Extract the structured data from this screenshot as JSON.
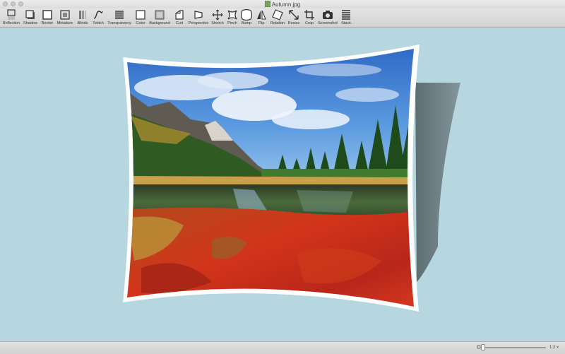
{
  "window": {
    "title": "Autumn.jpg",
    "traffic_lights": [
      "close",
      "minimize",
      "zoom"
    ]
  },
  "toolbar": {
    "items": [
      {
        "label": "Reflection",
        "icon": "reflection-icon"
      },
      {
        "label": "Shadow",
        "icon": "shadow-icon"
      },
      {
        "label": "Border",
        "icon": "border-icon"
      },
      {
        "label": "Miniature",
        "icon": "miniature-icon"
      },
      {
        "label": "Blinds",
        "icon": "blinds-icon"
      },
      {
        "label": "Twitch",
        "icon": "twitch-icon"
      },
      {
        "label": "Transparency",
        "icon": "transparency-icon"
      },
      {
        "label": "Color",
        "icon": "color-icon"
      },
      {
        "label": "Background",
        "icon": "background-icon"
      },
      {
        "label": "Curl",
        "icon": "curl-icon"
      },
      {
        "label": "Perspective",
        "icon": "perspective-icon"
      },
      {
        "label": "Stretch",
        "icon": "stretch-icon"
      },
      {
        "label": "Pinch",
        "icon": "pinch-icon"
      },
      {
        "label": "Bump",
        "icon": "bump-icon"
      },
      {
        "label": "Flip",
        "icon": "flip-icon"
      },
      {
        "label": "Rotation",
        "icon": "rotation-icon"
      },
      {
        "label": "Resize",
        "icon": "resize-icon"
      },
      {
        "label": "Crop",
        "icon": "crop-icon"
      },
      {
        "label": "Screenshot",
        "icon": "screenshot-icon"
      },
      {
        "label": "Stack",
        "icon": "stack-icon"
      }
    ]
  },
  "canvas": {
    "background_color": "#b6d6e0",
    "image": "autumn-landscape"
  },
  "statusbar": {
    "zoom_label": "1:2 x",
    "zoom_level": 0.02
  },
  "colors": {
    "sky": "#3a78c8",
    "foliage_red": "#c3301a",
    "forest_green": "#2e5a22",
    "shadow": "#5b6b6e"
  }
}
